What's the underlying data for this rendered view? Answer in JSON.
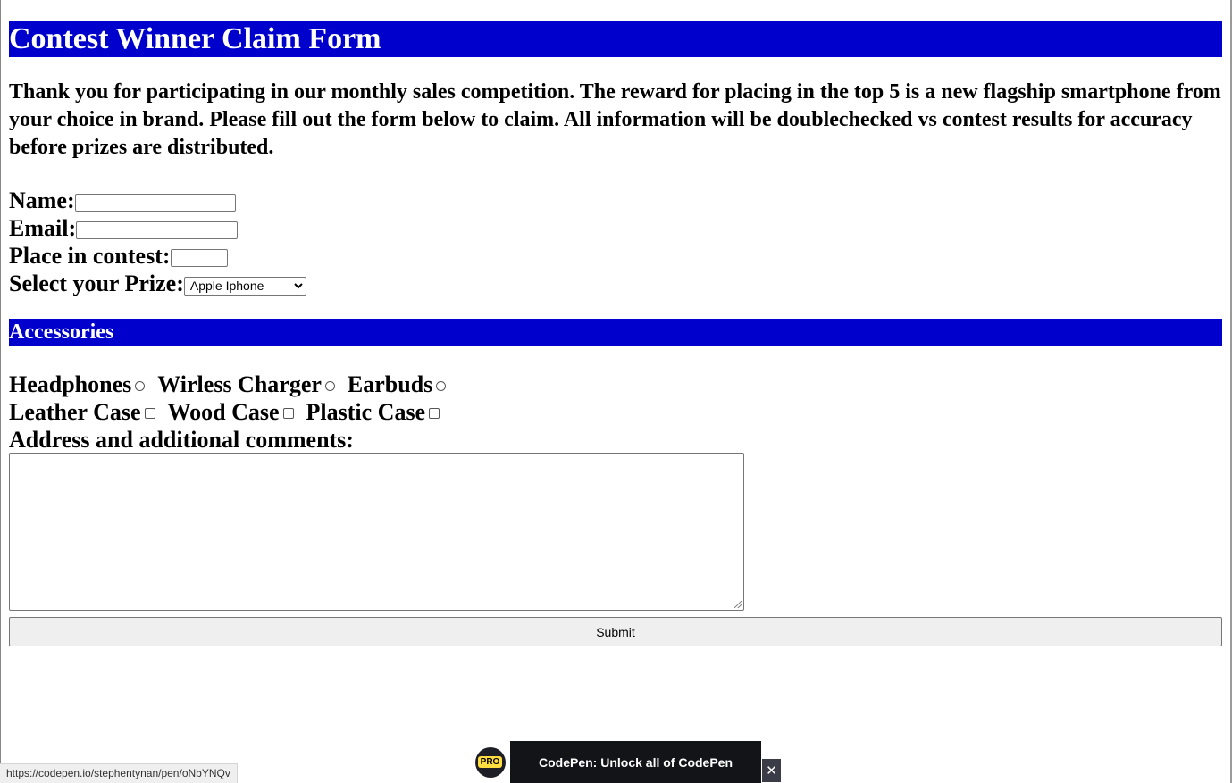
{
  "form": {
    "title": "Contest Winner Claim Form",
    "intro": "Thank you for participating in our monthly sales competition. The reward for placing in the top 5 is a new flagship smartphone from your choice in brand. Please fill out the form below to claim. All information will be doublechecked vs contest results for accuracy before prizes are distributed.",
    "name_label": "Name:",
    "name_value": "",
    "email_label": "Email:",
    "email_value": "",
    "place_label": "Place in contest:",
    "place_value": "",
    "prize_label": "Select your Prize:",
    "prize_selected": "Apple Iphone"
  },
  "accessories": {
    "heading": "Accessories",
    "radios": [
      "Headphones",
      "Wirless Charger",
      "Earbuds"
    ],
    "checkboxes": [
      "Leather Case",
      "Wood Case",
      "Plastic Case"
    ],
    "comments_label": "Address and additional comments:",
    "comments_value": ""
  },
  "submit_label": "Submit",
  "status_url": "https://codepen.io/stephentynan/pen/oNbYNQv",
  "promo": {
    "badge": "PRO",
    "text": "CodePen: Unlock all of CodePen",
    "close": "✕"
  }
}
